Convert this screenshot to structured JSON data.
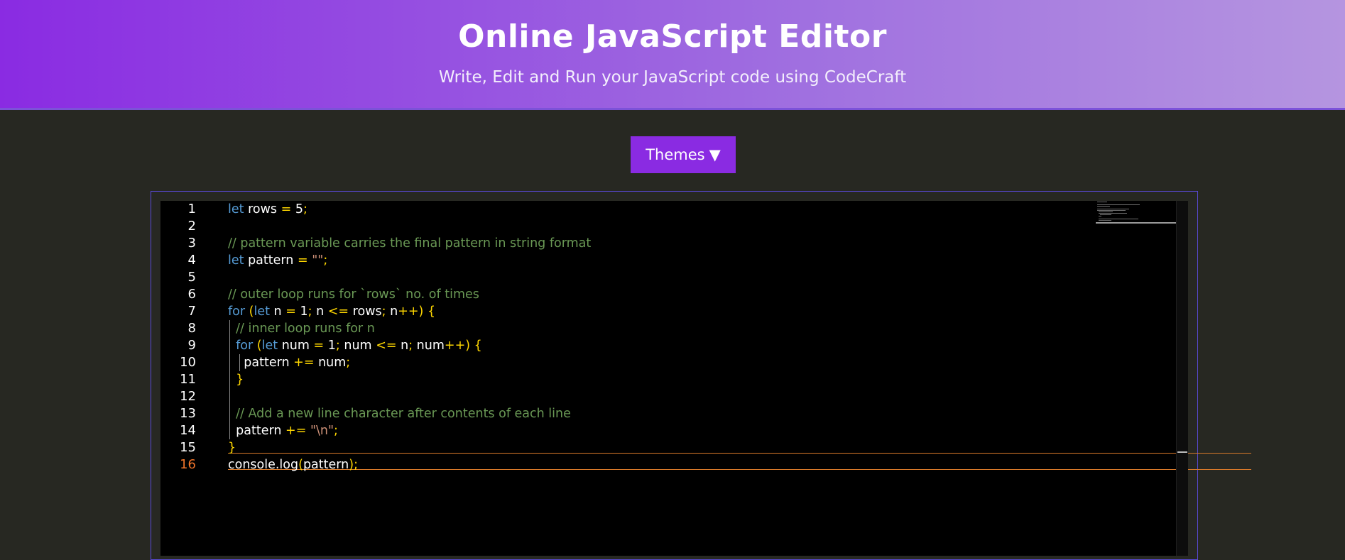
{
  "header": {
    "title": "Online JavaScript Editor",
    "subtitle": "Write, Edit and Run your JavaScript code using CodeCraft"
  },
  "toolbar": {
    "themes_label": "Themes",
    "themes_arrow": "▼"
  },
  "editor": {
    "active_line": 16,
    "line_numbers": [
      "1",
      "2",
      "3",
      "4",
      "5",
      "6",
      "7",
      "8",
      "9",
      "10",
      "11",
      "12",
      "13",
      "14",
      "15",
      "16"
    ],
    "lines": [
      "let rows = 5;",
      "",
      "// pattern variable carries the final pattern in string format",
      "let pattern = \"\";",
      "",
      "// outer loop runs for `rows` no. of times",
      "for (let n = 1; n <= rows; n++) {",
      "  // inner loop runs for n",
      "  for (let num = 1; num <= n; num++) {",
      "    pattern += num;",
      "  }",
      "",
      "  // Add a new line character after contents of each line",
      "  pattern += \"\\n\";",
      "}",
      "console.log(pattern);"
    ]
  },
  "colors": {
    "header_gradient_start": "#8a2be2",
    "header_gradient_end": "#b595e0",
    "button": "#8a2be2",
    "page_bg": "#272822",
    "editor_bg": "#000000",
    "keyword": "#569cd6",
    "comment": "#6a9955",
    "string": "#ce9178",
    "operator": "#ffd700",
    "active_line_number": "#f0742a"
  }
}
